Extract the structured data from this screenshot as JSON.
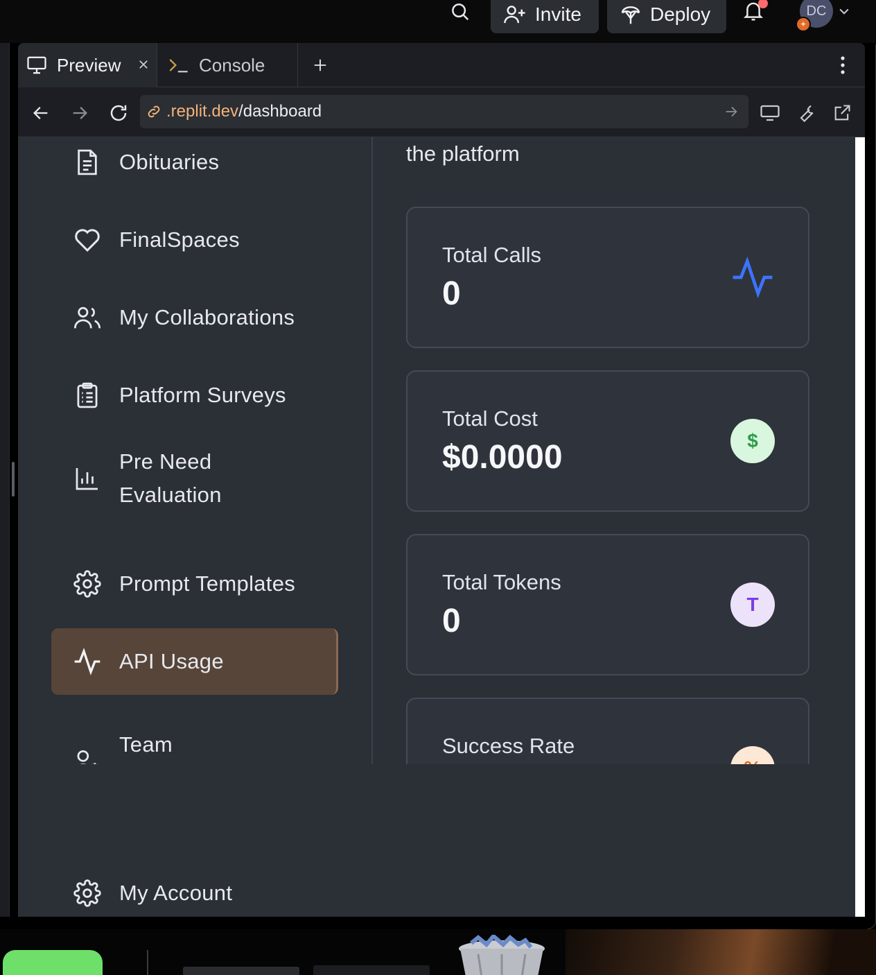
{
  "topbar": {
    "invite_label": "Invite",
    "deploy_label": "Deploy",
    "avatar_initials": "DC"
  },
  "tabs": [
    {
      "label": "Preview",
      "icon": "monitor-icon"
    },
    {
      "label": "Console",
      "icon": "terminal-icon"
    }
  ],
  "urlbar": {
    "domain": ".replit.dev",
    "path": "/dashboard"
  },
  "sidebar": {
    "items": [
      {
        "label": "Obituaries",
        "icon": "document-icon"
      },
      {
        "label": "FinalSpaces",
        "icon": "heart-icon"
      },
      {
        "label": "My Collaborations",
        "icon": "users-icon"
      },
      {
        "label": "Platform Surveys",
        "icon": "clipboard-icon"
      },
      {
        "label": "Pre Need Evaluation",
        "icon": "bar-chart-icon"
      },
      {
        "label": "Prompt Templates",
        "icon": "gear-icon"
      },
      {
        "label": "API Usage",
        "icon": "activity-icon",
        "active": true
      },
      {
        "label": "Team Management",
        "icon": "user-cog-icon"
      },
      {
        "label": "My Account",
        "icon": "gear-icon"
      }
    ]
  },
  "main": {
    "intro_text": "the platform",
    "cards": [
      {
        "label": "Total Calls",
        "value": "0",
        "icon": "activity-icon",
        "accent": "#3b74ff"
      },
      {
        "label": "Total Cost",
        "value": "$0.0000",
        "icon": "dollar-icon",
        "icon_text": "$",
        "accent": "#2f9a4a"
      },
      {
        "label": "Total Tokens",
        "value": "0",
        "icon": "token-icon",
        "icon_text": "T",
        "accent": "#7a3fe0"
      },
      {
        "label": "Success Rate",
        "value": "",
        "icon": "percent-icon",
        "icon_text": "%",
        "accent": "#e06a2a"
      }
    ]
  },
  "colors": {
    "sidebar_active_bg": "#574539",
    "viewport_bg": "#2b2f36",
    "card_bg": "#2f333b",
    "url_domain": "#f2b37a"
  }
}
